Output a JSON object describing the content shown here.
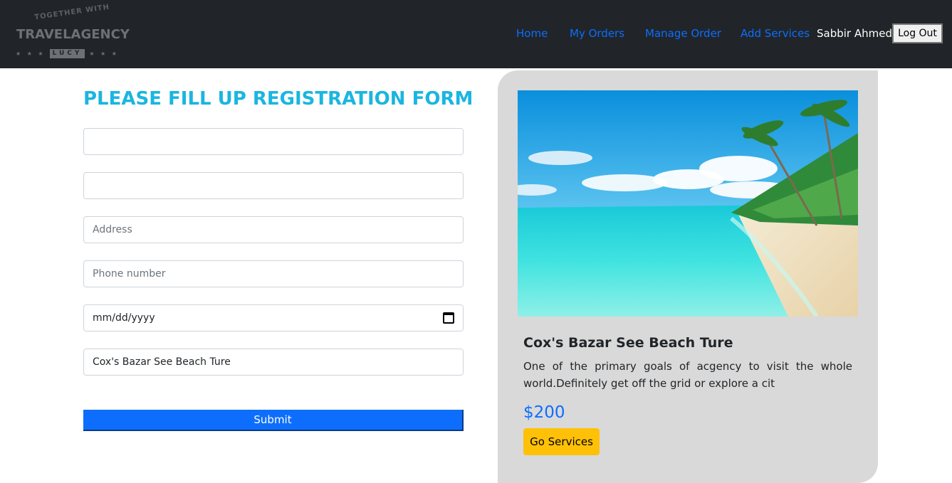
{
  "navbar": {
    "logo": {
      "top_text": "TOGETHER WITH",
      "main_text": "TRAVELAGENCY",
      "badge_text": "LUCY",
      "stars": "★ ★ ★"
    },
    "links": {
      "home": "Home",
      "my_orders": "My Orders",
      "manage_order": "Manage Order",
      "add_services": "Add Services"
    },
    "user_name": "Sabbir Ahmed",
    "logout_label": "Log Out"
  },
  "form": {
    "title": "PLEASE FILL UP REGISTRATION FORM",
    "name_value": "",
    "email_value": "",
    "address_placeholder": "Address",
    "phone_placeholder": "Phone number",
    "date_placeholder": "mm/dd/yyyy",
    "service_value": "Cox's Bazar See Beach Ture",
    "submit_label": "Submit"
  },
  "card": {
    "title": "Cox's Bazar See Beach Ture",
    "description": "One of the primary goals of acgency to visit the whole world.Definitely get off the grid or explore a cit",
    "price": "$200",
    "button_label": "Go Services"
  },
  "colors": {
    "navbar_bg": "#212529",
    "link": "#0d6efd",
    "title": "#1ab6e0",
    "submit": "#0d6efd",
    "card_bg": "#d9d9d9",
    "go_button": "#ffc107"
  }
}
